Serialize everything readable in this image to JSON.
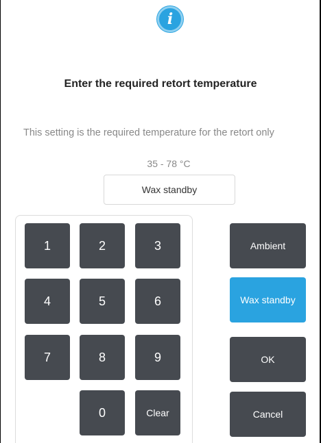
{
  "dialog": {
    "title": "Enter the required retort temperature",
    "description": "This setting is the required temperature for the retort only",
    "range": "35 - 78 °C",
    "current_value": "Wax standby"
  },
  "keypad": {
    "k1": "1",
    "k2": "2",
    "k3": "3",
    "k4": "4",
    "k5": "5",
    "k6": "6",
    "k7": "7",
    "k8": "8",
    "k9": "9",
    "k0": "0",
    "clear": "Clear"
  },
  "options": {
    "ambient": "Ambient",
    "wax_standby": "Wax standby",
    "ok": "OK",
    "cancel": "Cancel"
  },
  "colors": {
    "accent": "#2aa3e0",
    "key_bg": "#464a50"
  },
  "icons": {
    "header": "info-icon"
  }
}
